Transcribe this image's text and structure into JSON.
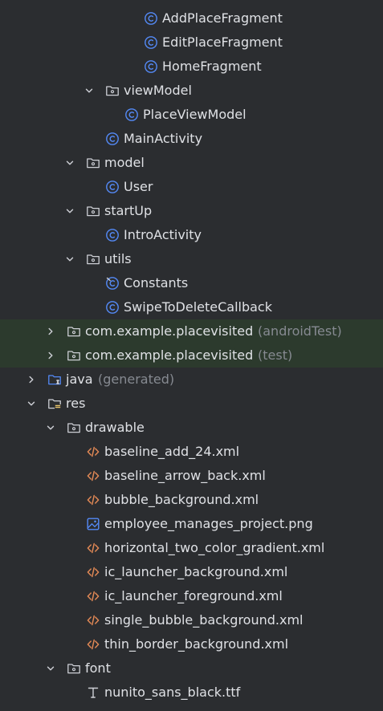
{
  "tree": {
    "rows": [
      {
        "depth": 6,
        "chevron": "none",
        "icon": "class-icon",
        "label": "AddPlaceFragment",
        "suffix": "",
        "highlight": false,
        "interactable": true
      },
      {
        "depth": 6,
        "chevron": "none",
        "icon": "class-icon",
        "label": "EditPlaceFragment",
        "suffix": "",
        "highlight": false,
        "interactable": true
      },
      {
        "depth": 6,
        "chevron": "none",
        "icon": "class-icon",
        "label": "HomeFragment",
        "suffix": "",
        "highlight": false,
        "interactable": true
      },
      {
        "depth": 4,
        "chevron": "down",
        "icon": "package-folder-icon",
        "label": "viewModel",
        "suffix": "",
        "highlight": false,
        "interactable": true
      },
      {
        "depth": 5,
        "chevron": "none",
        "icon": "class-icon",
        "label": "PlaceViewModel",
        "suffix": "",
        "highlight": false,
        "interactable": true
      },
      {
        "depth": 4,
        "chevron": "none",
        "icon": "class-icon",
        "label": "MainActivity",
        "suffix": "",
        "highlight": false,
        "interactable": true
      },
      {
        "depth": 3,
        "chevron": "down",
        "icon": "package-folder-icon",
        "label": "model",
        "suffix": "",
        "highlight": false,
        "interactable": true
      },
      {
        "depth": 4,
        "chevron": "none",
        "icon": "class-icon",
        "label": "User",
        "suffix": "",
        "highlight": false,
        "interactable": true
      },
      {
        "depth": 3,
        "chevron": "down",
        "icon": "package-folder-icon",
        "label": "startUp",
        "suffix": "",
        "highlight": false,
        "interactable": true
      },
      {
        "depth": 4,
        "chevron": "none",
        "icon": "class-icon",
        "label": "IntroActivity",
        "suffix": "",
        "highlight": false,
        "interactable": true
      },
      {
        "depth": 3,
        "chevron": "down",
        "icon": "package-folder-icon",
        "label": "utils",
        "suffix": "",
        "highlight": false,
        "interactable": true
      },
      {
        "depth": 4,
        "chevron": "none",
        "icon": "object-class-icon",
        "label": "Constants",
        "suffix": "",
        "highlight": false,
        "interactable": true
      },
      {
        "depth": 4,
        "chevron": "none",
        "icon": "class-icon",
        "label": "SwipeToDeleteCallback",
        "suffix": "",
        "highlight": false,
        "interactable": true
      },
      {
        "depth": 2,
        "chevron": "right",
        "icon": "package-folder-icon",
        "label": "com.example.placevisited",
        "suffix": "(androidTest)",
        "highlight": true,
        "interactable": true
      },
      {
        "depth": 2,
        "chevron": "right",
        "icon": "package-folder-icon",
        "label": "com.example.placevisited",
        "suffix": "(test)",
        "highlight": true,
        "interactable": true
      },
      {
        "depth": 1,
        "chevron": "right",
        "icon": "generated-source-folder-icon",
        "label": "java",
        "suffix": "(generated)",
        "highlight": false,
        "interactable": true
      },
      {
        "depth": 1,
        "chevron": "down",
        "icon": "resource-folder-icon",
        "label": "res",
        "suffix": "",
        "highlight": false,
        "interactable": true
      },
      {
        "depth": 2,
        "chevron": "down",
        "icon": "package-folder-icon",
        "label": "drawable",
        "suffix": "",
        "highlight": false,
        "interactable": true
      },
      {
        "depth": 3,
        "chevron": "none",
        "icon": "xml-file-icon",
        "label": "baseline_add_24.xml",
        "suffix": "",
        "highlight": false,
        "interactable": true
      },
      {
        "depth": 3,
        "chevron": "none",
        "icon": "xml-file-icon",
        "label": "baseline_arrow_back.xml",
        "suffix": "",
        "highlight": false,
        "interactable": true
      },
      {
        "depth": 3,
        "chevron": "none",
        "icon": "xml-file-icon",
        "label": "bubble_background.xml",
        "suffix": "",
        "highlight": false,
        "interactable": true
      },
      {
        "depth": 3,
        "chevron": "none",
        "icon": "image-file-icon",
        "label": "employee_manages_project.png",
        "suffix": "",
        "highlight": false,
        "interactable": true
      },
      {
        "depth": 3,
        "chevron": "none",
        "icon": "xml-file-icon",
        "label": "horizontal_two_color_gradient.xml",
        "suffix": "",
        "highlight": false,
        "interactable": true
      },
      {
        "depth": 3,
        "chevron": "none",
        "icon": "xml-file-icon",
        "label": "ic_launcher_background.xml",
        "suffix": "",
        "highlight": false,
        "interactable": true
      },
      {
        "depth": 3,
        "chevron": "none",
        "icon": "xml-file-icon",
        "label": "ic_launcher_foreground.xml",
        "suffix": "",
        "highlight": false,
        "interactable": true
      },
      {
        "depth": 3,
        "chevron": "none",
        "icon": "xml-file-icon",
        "label": "single_bubble_background.xml",
        "suffix": "",
        "highlight": false,
        "interactable": true
      },
      {
        "depth": 3,
        "chevron": "none",
        "icon": "xml-file-icon",
        "label": "thin_border_background.xml",
        "suffix": "",
        "highlight": false,
        "interactable": true
      },
      {
        "depth": 2,
        "chevron": "down",
        "icon": "package-folder-icon",
        "label": "font",
        "suffix": "",
        "highlight": false,
        "interactable": true
      },
      {
        "depth": 3,
        "chevron": "none",
        "icon": "font-file-icon",
        "label": "nunito_sans_black.ttf",
        "suffix": "",
        "highlight": false,
        "interactable": true
      },
      {
        "depth": 3,
        "chevron": "none",
        "icon": "font-file-icon",
        "label": "",
        "suffix": "",
        "highlight": false,
        "interactable": true
      }
    ]
  },
  "colors": {
    "background": "#2b2d30",
    "highlight_row": "#2c3a2d",
    "text": "#dfe1e5",
    "muted_text": "#868a91",
    "class_icon": "#548af7",
    "xml_icon": "#e08855",
    "folder_icon": "#ced0d6",
    "chevron": "#ced0d6",
    "resource_accent": "#e8c46a",
    "generated_accent": "#548af7"
  }
}
